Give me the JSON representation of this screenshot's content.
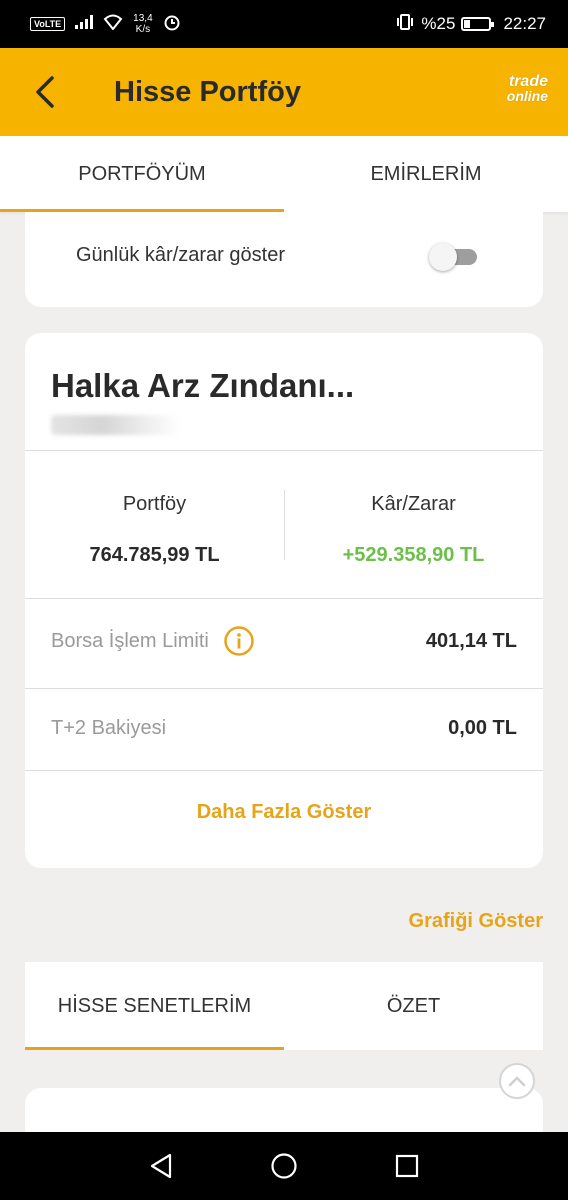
{
  "status_bar": {
    "volte": "VoLTE",
    "speed_value": "13,4",
    "speed_unit": "K/s",
    "battery_text": "%25",
    "battery_level": 0.25,
    "time": "22:27"
  },
  "header": {
    "title": "Hisse Portföy",
    "logo_line1": "trade",
    "logo_line2": "online"
  },
  "tabs": [
    {
      "label": "PORTFÖYÜM",
      "active": true
    },
    {
      "label": "EMİRLERİM",
      "active": false
    }
  ],
  "daily_toggle": {
    "label": "Günlük kâr/zarar göster",
    "on": false
  },
  "account": {
    "name": "Halka Arz Zındanı...",
    "portfolio_label": "Portföy",
    "portfolio_value": "764.785,99 TL",
    "pnl_label": "Kâr/Zarar",
    "pnl_value": "+529.358,90 TL",
    "limit_label": "Borsa İşlem Limiti",
    "limit_value": "401,14 TL",
    "t2_label": "T+2 Bakiyesi",
    "t2_value": "0,00 TL",
    "more_label": "Daha Fazla Göster"
  },
  "show_chart": "Grafiği Göster",
  "subtabs": [
    {
      "label": "HİSSE SENETLERİM",
      "active": true
    },
    {
      "label": "ÖZET",
      "active": false
    }
  ],
  "colors": {
    "accent": "#f6b400",
    "link": "#e8a418",
    "positive": "#6cc04a"
  }
}
